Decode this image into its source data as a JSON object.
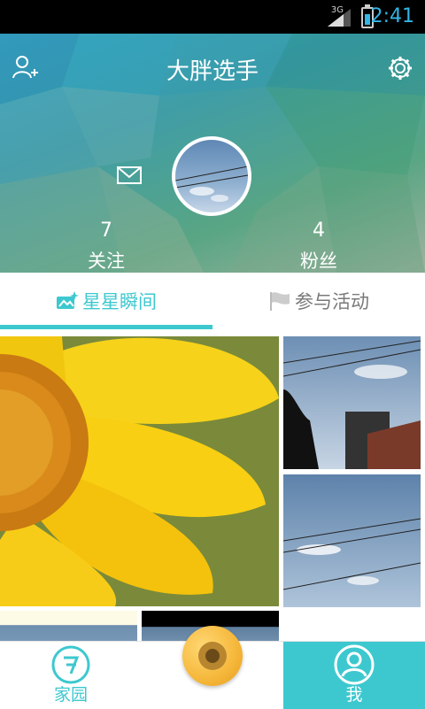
{
  "status_bar": {
    "network": "3G",
    "time": "2:41"
  },
  "header": {
    "title": "大胖选手",
    "following": {
      "count": "7",
      "label": "关注"
    },
    "followers": {
      "count": "4",
      "label": "粉丝"
    }
  },
  "tabs": [
    {
      "label": "星星瞬间",
      "active": true
    },
    {
      "label": "参与活动",
      "active": false
    }
  ],
  "bottom_nav": {
    "home_label": "家园",
    "me_label": "我"
  },
  "colors": {
    "accent": "#3dc8cf",
    "camera": "#f5b73a",
    "status_time": "#33b5e5"
  },
  "icons": [
    "add-friend-icon",
    "settings-gear-icon",
    "mail-icon",
    "home-logo-icon",
    "camera-icon",
    "profile-person-icon",
    "sparkle-photo-icon",
    "flag-icon"
  ]
}
